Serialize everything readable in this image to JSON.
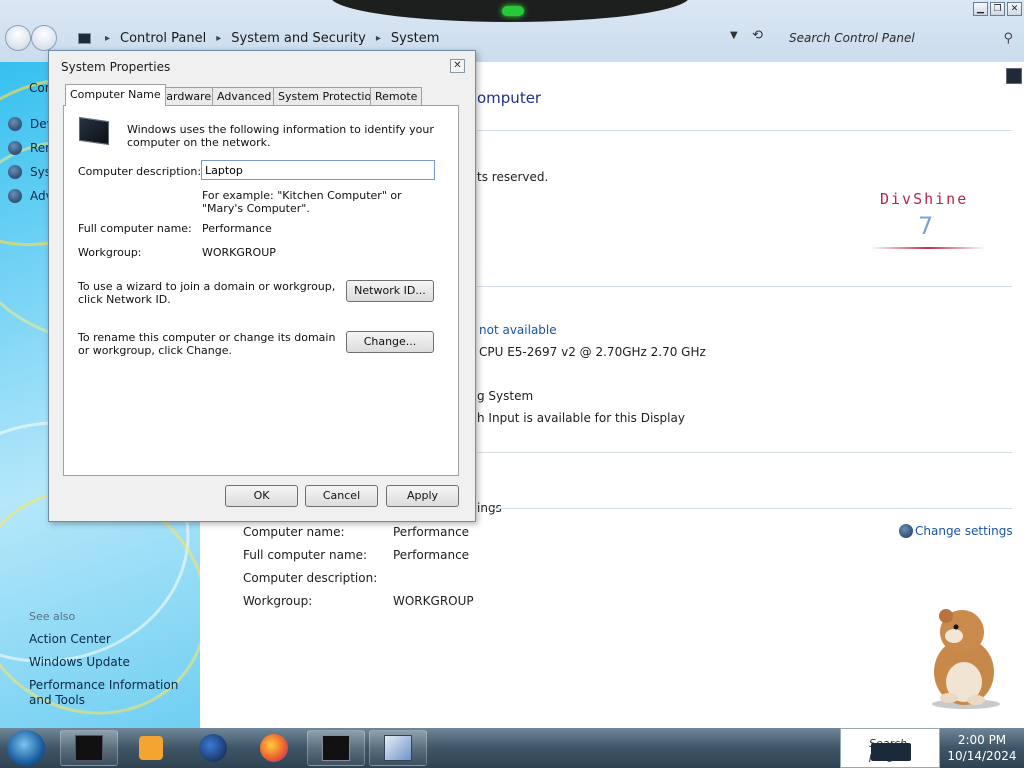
{
  "explorer": {
    "breadcrumb": [
      "Control Panel",
      "System and Security",
      "System"
    ],
    "search_placeholder": "Search Control Panel",
    "left_pane": {
      "items": [
        "Dev",
        "Ren",
        "Syst",
        "Adv"
      ],
      "partial_heading": "Cor",
      "see_also": "See also",
      "links": [
        "Action Center",
        "Windows Update",
        "Performance Information and Tools"
      ]
    },
    "main": {
      "title_fragment": "omputer",
      "rights_fragment": "ts reserved.",
      "rating_fragment": "not available",
      "processor_fragment": "CPU E5-2697 v2 @ 2.70GHz   2.70 GHz",
      "system_type_fragment": "g System",
      "pen_fragment": "h Input is available for this Display",
      "section_fragment": "ings",
      "logo_text": "DivShine",
      "logo_number": "7",
      "change_settings": "Change settings",
      "computer_rows": [
        {
          "label": "Computer name:",
          "value": "Performance"
        },
        {
          "label": "Full computer name:",
          "value": "Performance"
        },
        {
          "label": "Computer description:",
          "value": ""
        },
        {
          "label": "Workgroup:",
          "value": "WORKGROUP"
        }
      ]
    }
  },
  "dialog": {
    "title": "System Properties",
    "tabs": [
      "Computer Name",
      "Hardware",
      "Advanced",
      "System Protection",
      "Remote"
    ],
    "active_tab": "Computer Name",
    "intro": "Windows uses the following information to identify your computer on the network.",
    "description_label": "Computer description:",
    "description_value": "Laptop",
    "example_text": "For example: \"Kitchen Computer\" or \"Mary's Computer\".",
    "full_name_label": "Full computer name:",
    "full_name_value": "Performance",
    "workgroup_label": "Workgroup:",
    "workgroup_value": "WORKGROUP",
    "network_id_text": "To use a wizard to join a domain or workgroup, click Network ID.",
    "network_id_button": "Network ID...",
    "rename_text": "To rename this computer or change its domain or workgroup, click Change.",
    "change_button": "Change...",
    "ok_button": "OK",
    "cancel_button": "Cancel",
    "apply_button": "Apply"
  },
  "taskbar": {
    "tray_text": "Search progra",
    "time": "2:00 PM",
    "date": "10/14/2024"
  }
}
